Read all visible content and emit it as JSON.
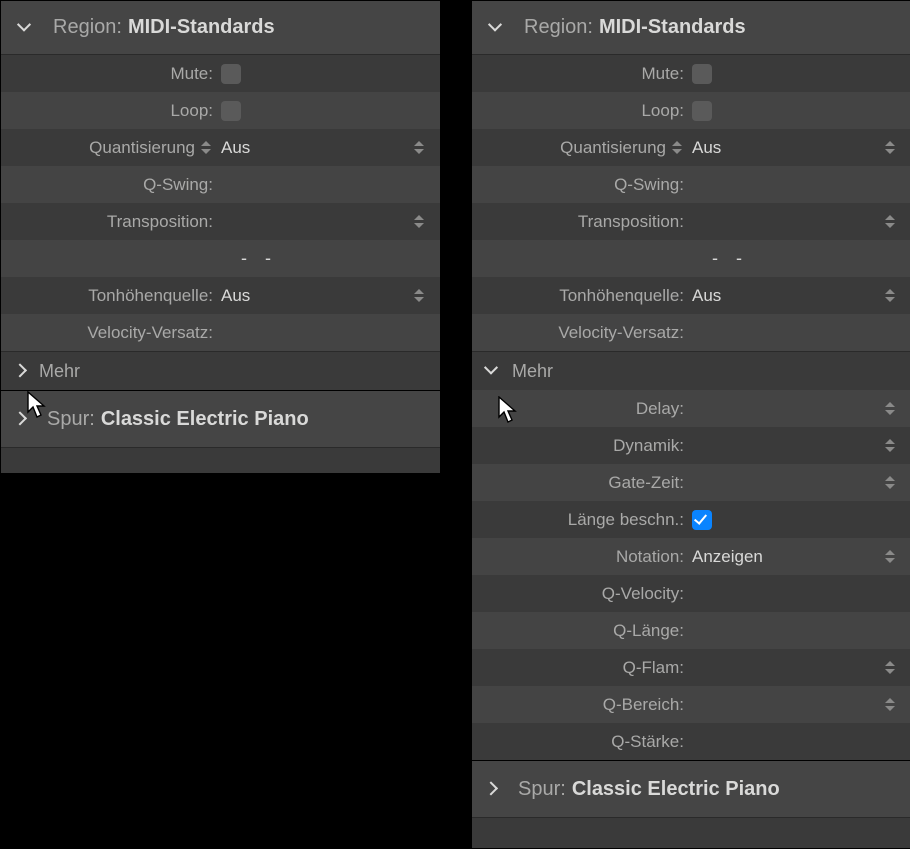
{
  "left": {
    "region": {
      "label": "Region:",
      "value": "MIDI-Standards"
    },
    "rows": {
      "mute": "Mute:",
      "loop": "Loop:",
      "quant_label": "Quantisierung",
      "quant_value": "Aus",
      "qswing": "Q-Swing:",
      "transposition": "Transposition:",
      "pitchsrc_label": "Tonhöhenquelle:",
      "pitchsrc_value": "Aus",
      "velocity": "Velocity-Versatz:"
    },
    "more": "Mehr",
    "spur": {
      "label": "Spur:",
      "value": "Classic Electric Piano"
    }
  },
  "right": {
    "region": {
      "label": "Region:",
      "value": "MIDI-Standards"
    },
    "rows": {
      "mute": "Mute:",
      "loop": "Loop:",
      "quant_label": "Quantisierung",
      "quant_value": "Aus",
      "qswing": "Q-Swing:",
      "transposition": "Transposition:",
      "pitchsrc_label": "Tonhöhenquelle:",
      "pitchsrc_value": "Aus",
      "velocity": "Velocity-Versatz:"
    },
    "more": "Mehr",
    "more_rows": {
      "delay": "Delay:",
      "dynamik": "Dynamik:",
      "gatezeit": "Gate-Zeit:",
      "laenge": "Länge beschn.:",
      "notation_label": "Notation:",
      "notation_value": "Anzeigen",
      "qvelocity": "Q-Velocity:",
      "qlaenge": "Q-Länge:",
      "qflam": "Q-Flam:",
      "qbereich": "Q-Bereich:",
      "qstaerke": "Q-Stärke:"
    },
    "spur": {
      "label": "Spur:",
      "value": "Classic Electric Piano"
    }
  }
}
